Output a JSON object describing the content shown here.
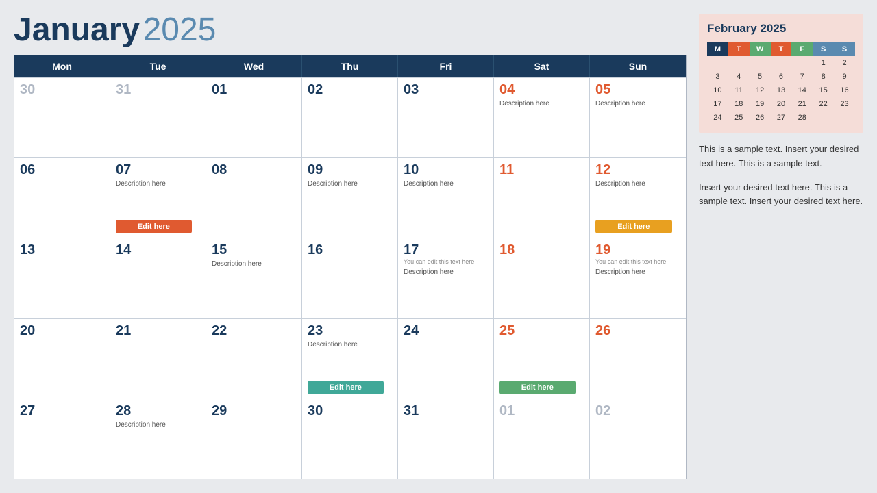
{
  "header": {
    "month": "January",
    "year": "2025"
  },
  "weekdays": [
    "Mon",
    "Tue",
    "Wed",
    "Thu",
    "Fri",
    "Sat",
    "Sun"
  ],
  "rows": [
    [
      {
        "num": "30",
        "faded": true
      },
      {
        "num": "31",
        "faded": true
      },
      {
        "num": "01"
      },
      {
        "num": "02"
      },
      {
        "num": "03"
      },
      {
        "num": "04",
        "weekend": true,
        "desc": "Description here"
      },
      {
        "num": "05",
        "weekend": true,
        "desc": "Description here"
      }
    ],
    [
      {
        "num": "06"
      },
      {
        "num": "07",
        "desc": "Description here",
        "btn": "Edit here",
        "btnColor": "red"
      },
      {
        "num": "08"
      },
      {
        "num": "09",
        "desc": "Description here"
      },
      {
        "num": "10",
        "desc": "Description here"
      },
      {
        "num": "11",
        "weekend": true
      },
      {
        "num": "12",
        "weekend": true,
        "desc": "Description here",
        "btn": "Edit here",
        "btnColor": "orange"
      }
    ],
    [
      {
        "num": "13"
      },
      {
        "num": "14"
      },
      {
        "num": "15",
        "desc": "Description here"
      },
      {
        "num": "16"
      },
      {
        "num": "17",
        "descSmall": "You can edit this text here.",
        "desc": "Description here"
      },
      {
        "num": "18",
        "weekend": true
      },
      {
        "num": "19",
        "weekend": true,
        "descSmall": "You can edit this text here.",
        "desc": "Description here"
      }
    ],
    [
      {
        "num": "20"
      },
      {
        "num": "21"
      },
      {
        "num": "22"
      },
      {
        "num": "23",
        "desc": "Description here",
        "btn": "Edit here",
        "btnColor": "teal"
      },
      {
        "num": "24"
      },
      {
        "num": "25",
        "weekend": true,
        "btn": "Edit here",
        "btnColor": "green"
      },
      {
        "num": "26",
        "weekend": true
      }
    ],
    [
      {
        "num": "27"
      },
      {
        "num": "28",
        "desc": "Description here"
      },
      {
        "num": "29"
      },
      {
        "num": "30"
      },
      {
        "num": "31"
      },
      {
        "num": "01",
        "faded": true
      },
      {
        "num": "02",
        "faded": true
      }
    ]
  ],
  "sidebar": {
    "miniCal": {
      "title": "February 2025",
      "headers": [
        "M",
        "T",
        "W",
        "T",
        "F",
        "S",
        "S"
      ],
      "rows": [
        [
          "",
          "",
          "",
          "",
          "",
          "1",
          "2"
        ],
        [
          "3",
          "4",
          "5",
          "6",
          "7",
          "8",
          "9"
        ],
        [
          "10",
          "11",
          "12",
          "13",
          "14",
          "15",
          "16"
        ],
        [
          "17",
          "18",
          "19",
          "20",
          "21",
          "22",
          "23"
        ],
        [
          "24",
          "25",
          "26",
          "27",
          "28",
          "",
          ""
        ]
      ]
    },
    "text1": "This is a sample text. Insert your desired text here. This is a sample text.",
    "text2": "Insert your desired text here. This is a sample text. Insert your desired text here."
  }
}
